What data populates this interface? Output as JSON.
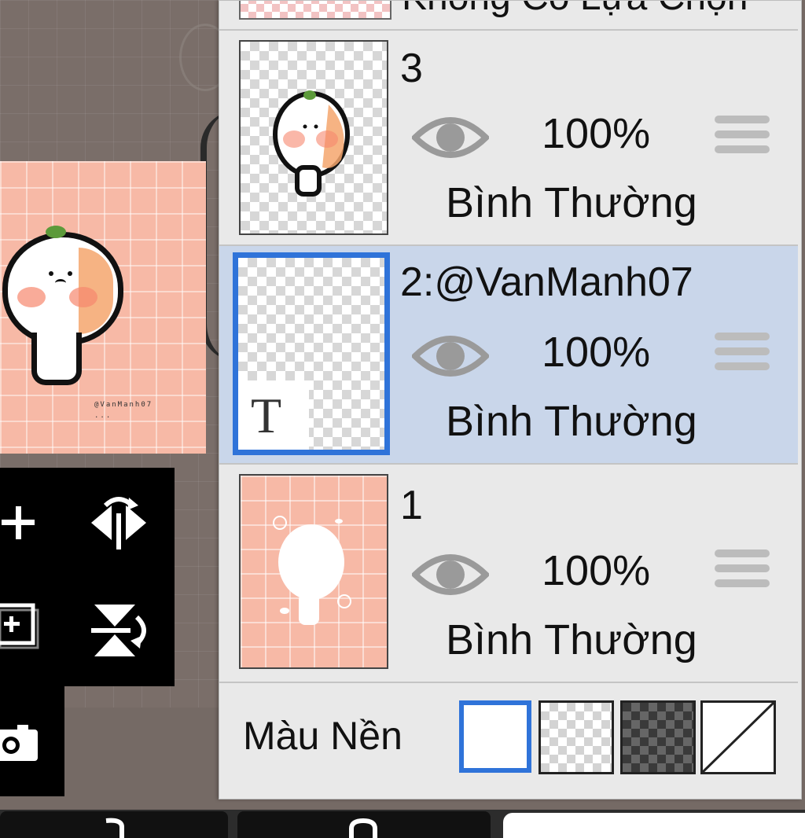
{
  "top_partial_layer": {
    "label": "Không Có Lựa Chọn"
  },
  "layers": [
    {
      "name": "3",
      "opacity": "100%",
      "blend_mode": "Bình Thường",
      "visible": true,
      "selected": false,
      "thumb_icon": "character-thumbnail"
    },
    {
      "name": "2:@VanManh07",
      "opacity": "100%",
      "blend_mode": "Bình Thường",
      "visible": true,
      "selected": true,
      "thumb_icon": "text-layer-thumbnail",
      "thumb_glyph": "T"
    },
    {
      "name": "1",
      "opacity": "100%",
      "blend_mode": "Bình Thường",
      "visible": true,
      "selected": false,
      "thumb_icon": "pink-background-thumbnail"
    }
  ],
  "background": {
    "label": "Màu Nền",
    "options": [
      "white",
      "transparent",
      "dark-checker",
      "none"
    ],
    "selected": "white"
  },
  "colors": {
    "selection_blue": "#2f73d9",
    "selected_row_bg": "#c9d6ea",
    "panel_bg": "#e9e9e9",
    "canvas_pink": "#f7b9a6"
  },
  "preview": {
    "watermark_line1": "@VanManh07",
    "watermark_line2": "..."
  },
  "toolbar_icons": [
    "add-layer-icon",
    "flip-horizontal-icon",
    "duplicate-layer-icon",
    "flip-vertical-icon",
    "camera-icon"
  ]
}
